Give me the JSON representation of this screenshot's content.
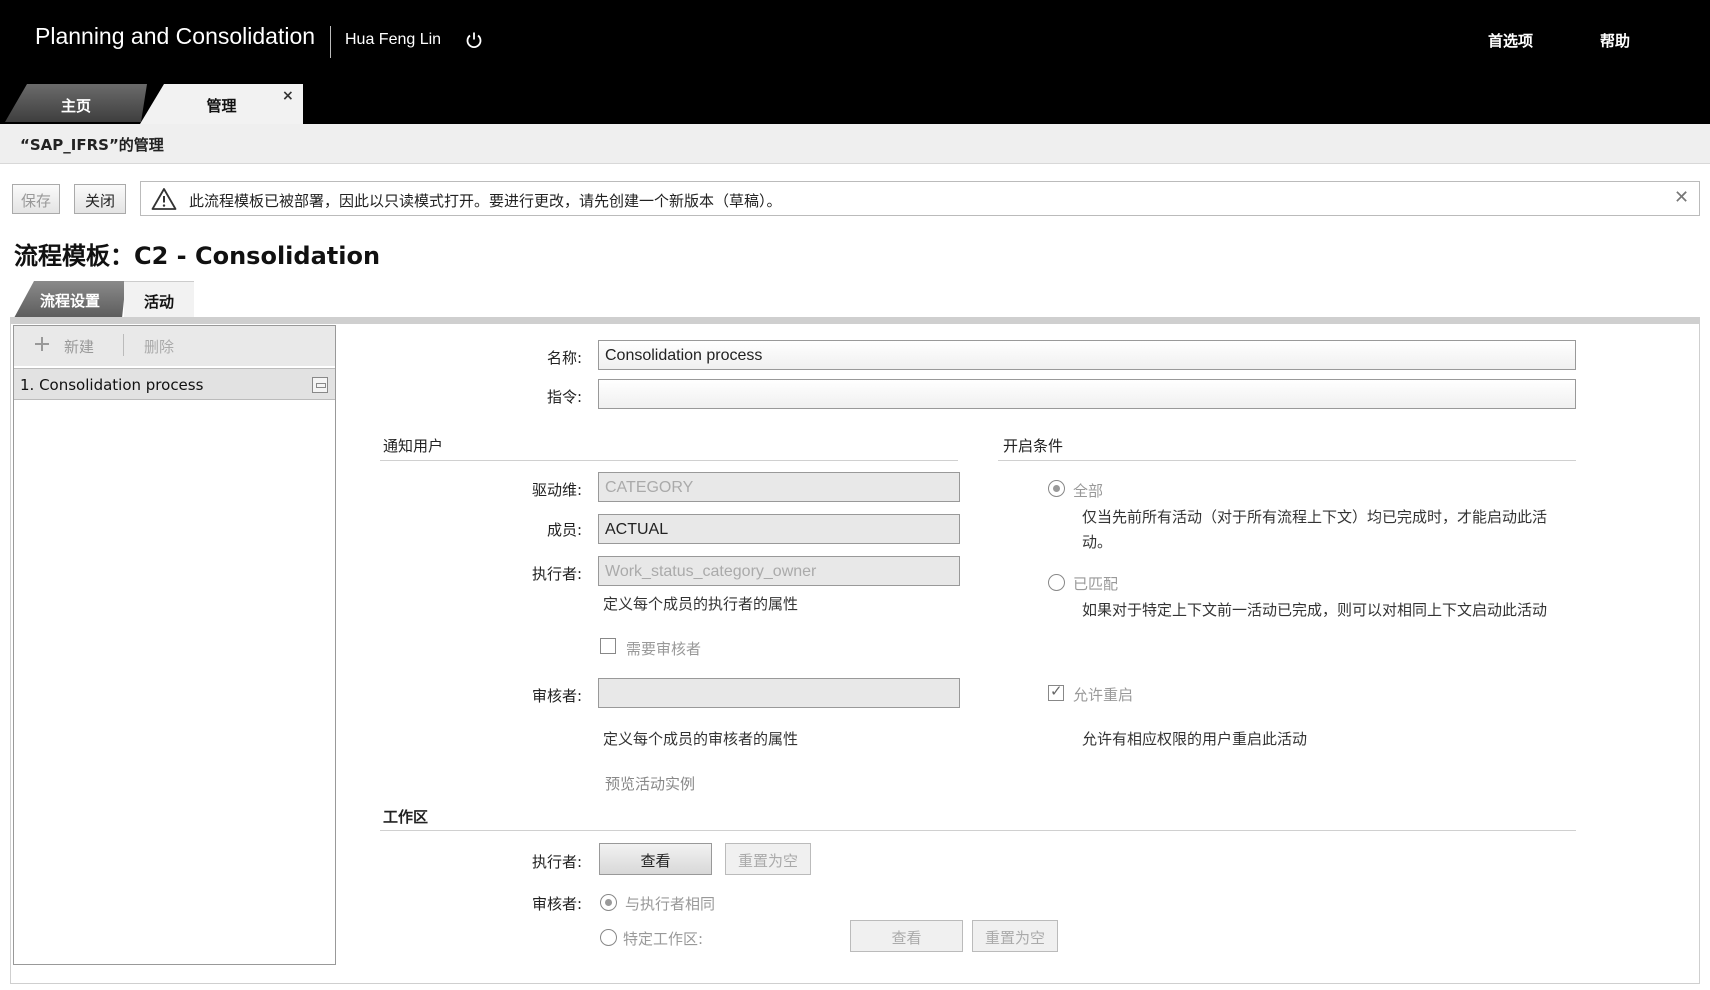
{
  "header": {
    "app_title": "Planning and Consolidation",
    "user_name": "Hua Feng Lin",
    "preferences_label": "首选项",
    "help_label": "帮助"
  },
  "main_tabs": [
    {
      "label": "主页",
      "active": false
    },
    {
      "label": "管理",
      "active": true
    }
  ],
  "breadcrumb": "“SAP_IFRS”的管理",
  "toolbar": {
    "save_label": "保存",
    "close_label": "关闭",
    "message": "此流程模板已被部署，因此以只读模式打开。要进行更改，请先创建一个新版本（草稿）。"
  },
  "page_title": "流程模板：C2 - Consolidation",
  "sub_tabs": [
    {
      "label": "流程设置",
      "active": false
    },
    {
      "label": "活动",
      "active": true
    }
  ],
  "left_panel": {
    "add_label": "新建",
    "delete_label": "删除",
    "items": [
      {
        "label": "1.  Consolidation process"
      }
    ]
  },
  "form": {
    "name_label": "名称:",
    "name_value": "Consolidation process",
    "instruction_label": "指令:",
    "instruction_value": "",
    "notify_section": "通知用户",
    "driver_label": "驱动维:",
    "driver_value": "CATEGORY",
    "member_label": "成员:",
    "member_value": "ACTUAL",
    "performer_label": "执行者:",
    "performer_value": "Work_status_category_owner",
    "performer_note": "定义每个成员的执行者的属性",
    "require_reviewer_label": "需要审核者",
    "reviewer_label": "审核者:",
    "reviewer_value": "",
    "reviewer_note": "定义每个成员的审核者的属性",
    "preview_link": "预览活动实例",
    "open_section": "开启条件",
    "all_label": "全部",
    "all_desc": "仅当先前所有活动（对于所有流程上下文）均已完成时，才能启动此活动。",
    "matched_label": "已匹配",
    "matched_desc": "如果对于特定上下文前一活动已完成，则可以对相同上下文启动此活动",
    "allow_reopen_label": "允许重启",
    "allow_reopen_desc": "允许有相应权限的用户重启此活动",
    "workspace_section": "工作区",
    "ws_performer_label": "执行者:",
    "view_label": "查看",
    "reset_label": "重置为空",
    "ws_reviewer_label": "审核者:",
    "same_as_performer_label": "与执行者相同",
    "specific_workspace_label": "特定工作区:",
    "view2_label": "查看",
    "reset2_label": "重置为空"
  }
}
